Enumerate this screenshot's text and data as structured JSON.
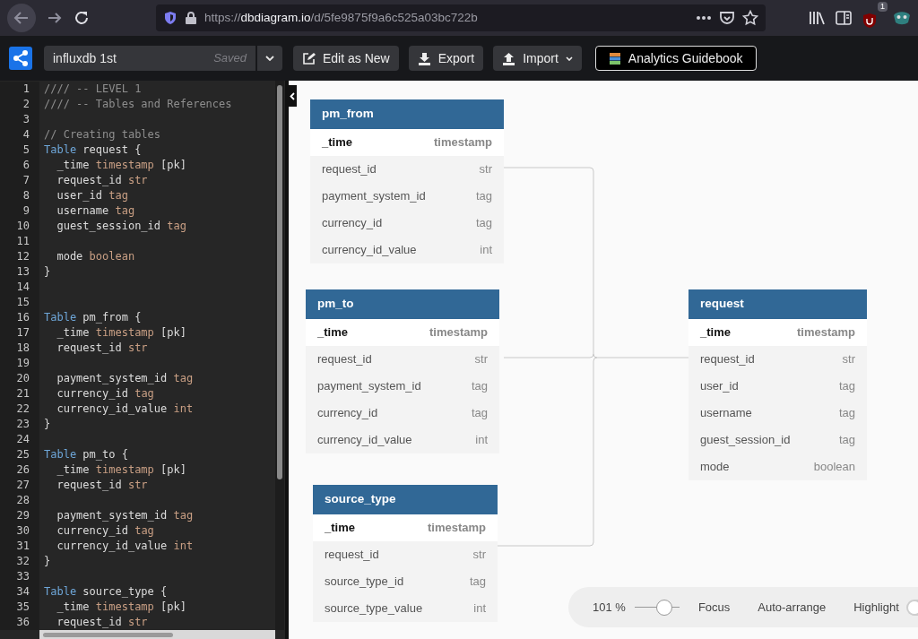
{
  "browser": {
    "url": {
      "scheme": "https://",
      "domain": "dbdiagram.io",
      "path": "/d/5fe9875f9a6c525a03bc722b"
    },
    "extension_badge": "1"
  },
  "toolbar": {
    "document_name": "influxdb 1st",
    "save_status": "Saved",
    "buttons": [
      {
        "kind": "edit",
        "label": "Edit as New"
      },
      {
        "kind": "export",
        "label": "Export"
      },
      {
        "kind": "import",
        "label": "Import"
      },
      {
        "kind": "guide",
        "label": "Analytics Guidebook"
      }
    ]
  },
  "editor": {
    "lines": [
      {
        "number": "1",
        "tokens": [
          {
            "kind": "comment",
            "text": "//// -- LEVEL 1"
          }
        ]
      },
      {
        "number": "2",
        "tokens": [
          {
            "kind": "comment",
            "text": "//// -- Tables and References"
          }
        ]
      },
      {
        "number": "3"
      },
      {
        "number": "4",
        "tokens": [
          {
            "kind": "comment",
            "text": "// Creating tables"
          }
        ]
      },
      {
        "number": "5",
        "tokens": [
          {
            "kind": "keyword",
            "text": "Table"
          },
          {
            "kind": "plain",
            "text": " request {"
          }
        ]
      },
      {
        "number": "6",
        "tokens": [
          {
            "kind": "plain",
            "text": "  _time "
          },
          {
            "kind": "type",
            "text": "timestamp"
          },
          {
            "kind": "plain",
            "text": " [pk]"
          }
        ]
      },
      {
        "number": "7",
        "tokens": [
          {
            "kind": "plain",
            "text": "  request_id "
          },
          {
            "kind": "type",
            "text": "str"
          }
        ]
      },
      {
        "number": "8",
        "tokens": [
          {
            "kind": "plain",
            "text": "  user_id "
          },
          {
            "kind": "type",
            "text": "tag"
          }
        ]
      },
      {
        "number": "9",
        "tokens": [
          {
            "kind": "plain",
            "text": "  username "
          },
          {
            "kind": "type",
            "text": "tag"
          }
        ]
      },
      {
        "number": "10",
        "tokens": [
          {
            "kind": "plain",
            "text": "  guest_session_id "
          },
          {
            "kind": "type",
            "text": "tag"
          }
        ]
      },
      {
        "number": "11"
      },
      {
        "number": "12",
        "tokens": [
          {
            "kind": "plain",
            "text": "  mode "
          },
          {
            "kind": "type",
            "text": "boolean"
          }
        ]
      },
      {
        "number": "13",
        "tokens": [
          {
            "kind": "plain",
            "text": "}"
          }
        ]
      },
      {
        "number": "14"
      },
      {
        "number": "15"
      },
      {
        "number": "16",
        "tokens": [
          {
            "kind": "keyword",
            "text": "Table"
          },
          {
            "kind": "plain",
            "text": " pm_from {"
          }
        ]
      },
      {
        "number": "17",
        "tokens": [
          {
            "kind": "plain",
            "text": "  _time "
          },
          {
            "kind": "type",
            "text": "timestamp"
          },
          {
            "kind": "plain",
            "text": " [pk]"
          }
        ]
      },
      {
        "number": "18",
        "tokens": [
          {
            "kind": "plain",
            "text": "  request_id "
          },
          {
            "kind": "type",
            "text": "str"
          }
        ]
      },
      {
        "number": "19"
      },
      {
        "number": "20",
        "tokens": [
          {
            "kind": "plain",
            "text": "  payment_system_id "
          },
          {
            "kind": "type",
            "text": "tag"
          }
        ]
      },
      {
        "number": "21",
        "tokens": [
          {
            "kind": "plain",
            "text": "  currency_id "
          },
          {
            "kind": "type",
            "text": "tag"
          }
        ]
      },
      {
        "number": "22",
        "tokens": [
          {
            "kind": "plain",
            "text": "  currency_id_value "
          },
          {
            "kind": "type",
            "text": "int"
          }
        ]
      },
      {
        "number": "23",
        "tokens": [
          {
            "kind": "plain",
            "text": "}"
          }
        ]
      },
      {
        "number": "24"
      },
      {
        "number": "25",
        "tokens": [
          {
            "kind": "keyword",
            "text": "Table"
          },
          {
            "kind": "plain",
            "text": " pm_to {"
          }
        ]
      },
      {
        "number": "26",
        "tokens": [
          {
            "kind": "plain",
            "text": "  _time "
          },
          {
            "kind": "type",
            "text": "timestamp"
          },
          {
            "kind": "plain",
            "text": " [pk]"
          }
        ]
      },
      {
        "number": "27",
        "tokens": [
          {
            "kind": "plain",
            "text": "  request_id "
          },
          {
            "kind": "type",
            "text": "str"
          }
        ]
      },
      {
        "number": "28"
      },
      {
        "number": "29",
        "tokens": [
          {
            "kind": "plain",
            "text": "  payment_system_id "
          },
          {
            "kind": "type",
            "text": "tag"
          }
        ]
      },
      {
        "number": "30",
        "tokens": [
          {
            "kind": "plain",
            "text": "  currency_id "
          },
          {
            "kind": "type",
            "text": "tag"
          }
        ]
      },
      {
        "number": "31",
        "tokens": [
          {
            "kind": "plain",
            "text": "  currency_id_value "
          },
          {
            "kind": "type",
            "text": "int"
          }
        ]
      },
      {
        "number": "32",
        "tokens": [
          {
            "kind": "plain",
            "text": "}"
          }
        ]
      },
      {
        "number": "33"
      },
      {
        "number": "34",
        "tokens": [
          {
            "kind": "keyword",
            "text": "Table"
          },
          {
            "kind": "plain",
            "text": " source_type {"
          }
        ]
      },
      {
        "number": "35",
        "tokens": [
          {
            "kind": "plain",
            "text": "  _time "
          },
          {
            "kind": "type",
            "text": "timestamp"
          },
          {
            "kind": "plain",
            "text": " [pk]"
          }
        ]
      },
      {
        "number": "36",
        "tokens": [
          {
            "kind": "plain",
            "text": "  request_id "
          },
          {
            "kind": "type",
            "text": "str"
          }
        ]
      }
    ]
  },
  "diagram": {
    "tables": [
      {
        "name": "pm_from",
        "fields": [
          {
            "name": "_time",
            "type": "timestamp",
            "pk": true
          },
          {
            "name": "request_id",
            "type": "str",
            "pk": false
          },
          {
            "name": "payment_system_id",
            "type": "tag",
            "pk": false
          },
          {
            "name": "currency_id",
            "type": "tag",
            "pk": false
          },
          {
            "name": "currency_id_value",
            "type": "int",
            "pk": false
          }
        ]
      },
      {
        "name": "pm_to",
        "fields": [
          {
            "name": "_time",
            "type": "timestamp",
            "pk": true
          },
          {
            "name": "request_id",
            "type": "str",
            "pk": false
          },
          {
            "name": "payment_system_id",
            "type": "tag",
            "pk": false
          },
          {
            "name": "currency_id",
            "type": "tag",
            "pk": false
          },
          {
            "name": "currency_id_value",
            "type": "int",
            "pk": false
          }
        ]
      },
      {
        "name": "request",
        "fields": [
          {
            "name": "_time",
            "type": "timestamp",
            "pk": true
          },
          {
            "name": "request_id",
            "type": "str",
            "pk": false
          },
          {
            "name": "user_id",
            "type": "tag",
            "pk": false
          },
          {
            "name": "username",
            "type": "tag",
            "pk": false
          },
          {
            "name": "guest_session_id",
            "type": "tag",
            "pk": false
          },
          {
            "name": "mode",
            "type": "boolean",
            "pk": false
          }
        ]
      },
      {
        "name": "source_type",
        "fields": [
          {
            "name": "_time",
            "type": "timestamp",
            "pk": true
          },
          {
            "name": "request_id",
            "type": "str",
            "pk": false
          },
          {
            "name": "source_type_id",
            "type": "tag",
            "pk": false
          },
          {
            "name": "source_type_value",
            "type": "int",
            "pk": false
          }
        ]
      }
    ]
  },
  "zoom_bar": {
    "zoom": "101 %",
    "level": 0.66,
    "actions": [
      "Focus",
      "Auto-arrange"
    ],
    "highlight": {
      "label": "Highlight",
      "on": false
    }
  }
}
